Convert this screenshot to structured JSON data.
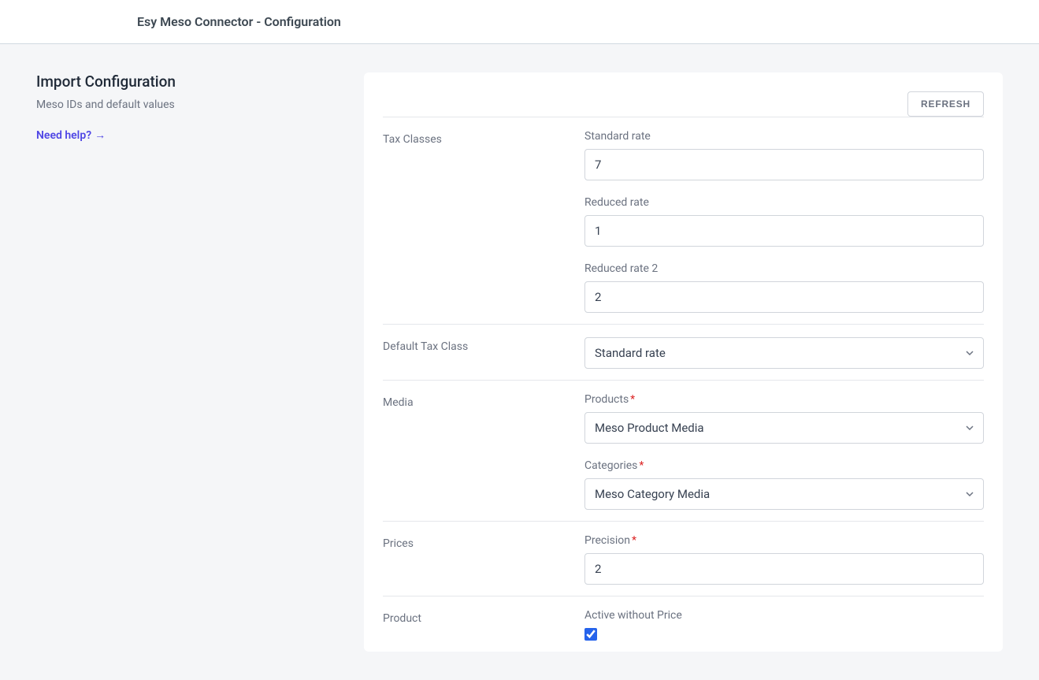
{
  "header": {
    "title": "Esy Meso Connector - Configuration"
  },
  "sidebar": {
    "title": "Import Configuration",
    "subtitle": "Meso IDs and default values",
    "help_text": "Need help?",
    "help_arrow": "→"
  },
  "card": {
    "refresh_button": "REFRESH",
    "sections": {
      "tax_classes": {
        "label": "Tax Classes",
        "standard_rate_label": "Standard rate",
        "standard_rate_value": "7",
        "reduced_rate_label": "Reduced rate",
        "reduced_rate_value": "1",
        "reduced_rate_2_label": "Reduced rate 2",
        "reduced_rate_2_value": "2"
      },
      "default_tax": {
        "label": "Default Tax Class",
        "value": "Standard rate"
      },
      "media": {
        "label": "Media",
        "products_label": "Products",
        "products_value": "Meso Product Media",
        "categories_label": "Categories",
        "categories_value": "Meso Category Media"
      },
      "prices": {
        "label": "Prices",
        "precision_label": "Precision",
        "precision_value": "2"
      },
      "product": {
        "label": "Product",
        "active_label": "Active without Price",
        "active_checked": true
      }
    }
  }
}
